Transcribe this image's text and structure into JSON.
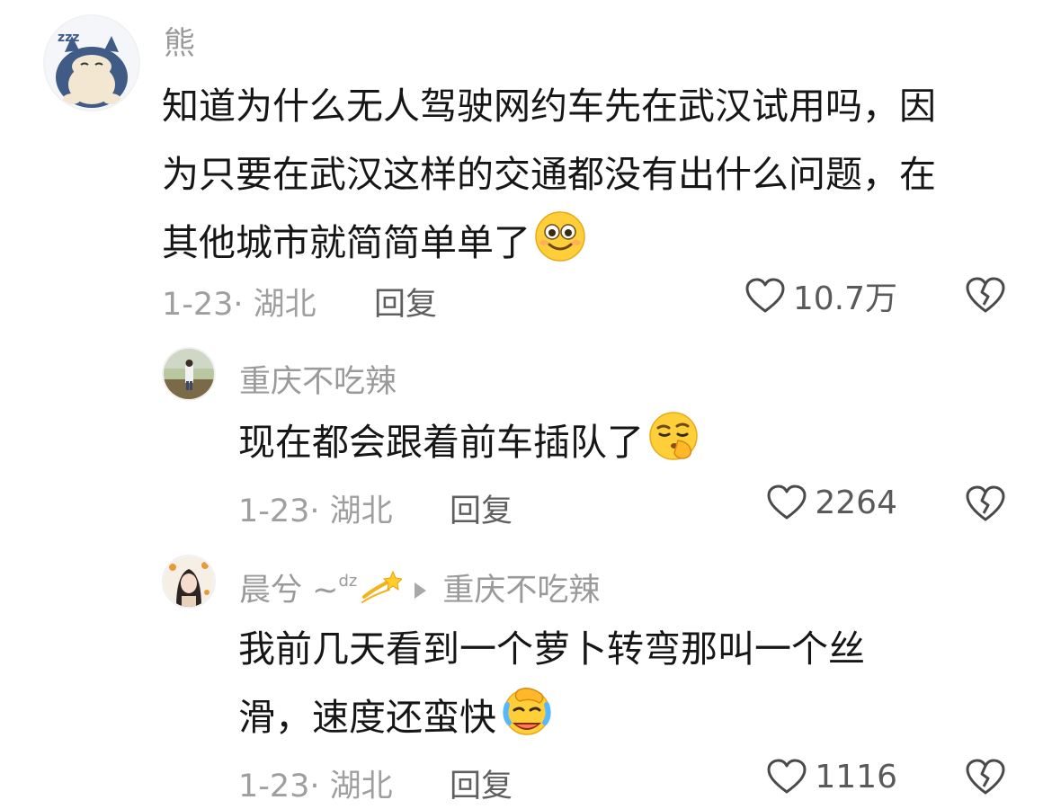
{
  "comments": [
    {
      "username": "熊",
      "text_lines": [
        "知道为什么无人驾驶网约车先在武汉试用吗，因",
        "为只要在武汉这样的交通都没有出什么问题，在",
        "其他城市就简简单单了"
      ],
      "emoji": "smiling-face-emoji",
      "meta": "1-23· 湖北",
      "reply_label": "回复",
      "likes": "10.7万"
    },
    {
      "username": "重庆不吃辣",
      "text_lines": [
        "现在都会跟着前车插队了"
      ],
      "emoji": "shushing-face-emoji",
      "meta": "1-23· 湖北",
      "reply_label": "回复",
      "likes": "2264"
    },
    {
      "username": "晨兮 ~",
      "username_sup": "dz",
      "username_emoji": "dizzy-emoji",
      "reply_to": "重庆不吃辣",
      "text_lines": [
        "我前几天看到一个萝卜转弯那叫一个丝",
        "滑，速度还蛮快"
      ],
      "emoji": "crying-laughing-emoji",
      "meta": "1-23· 湖北",
      "reply_label": "回复",
      "likes": "1116"
    }
  ],
  "colors": {
    "username": "#9a9a9a",
    "text": "#161616",
    "meta": "#9f9f9f",
    "reply": "#5f5f5f",
    "like": "#5a5a5a"
  }
}
